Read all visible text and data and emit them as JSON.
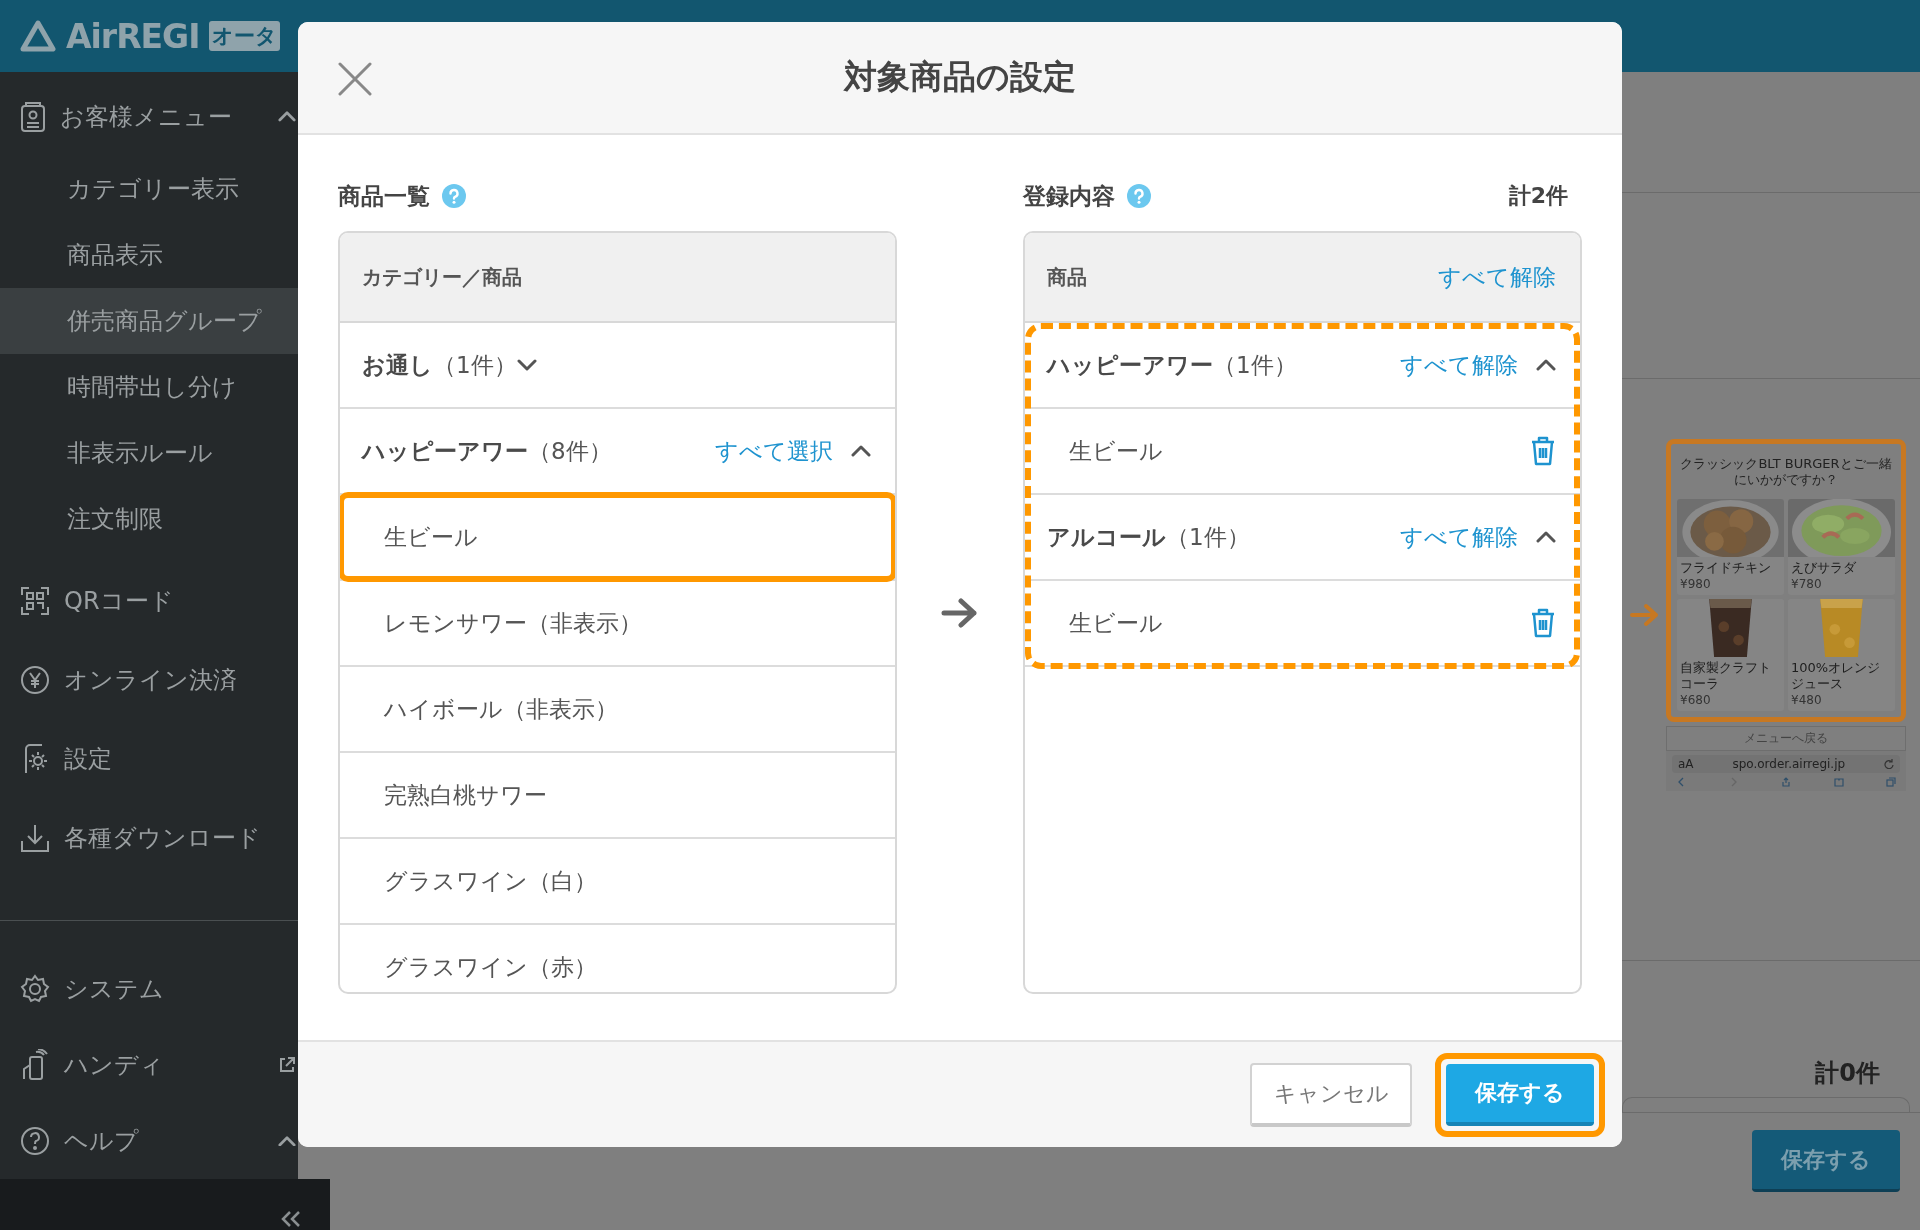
{
  "app_header": {
    "logo_text": "AirREGI",
    "logo_badge": "オータ"
  },
  "sidebar": {
    "items": [
      {
        "kind": "parent",
        "label": "お客様メニュー",
        "selected": false,
        "expanded": true,
        "children": [
          {
            "label": "カテゴリー表示",
            "selected": false
          },
          {
            "label": "商品表示",
            "selected": false
          },
          {
            "label": "併売商品グループ",
            "selected": true
          },
          {
            "label": "時間帯出し分け",
            "selected": false
          },
          {
            "label": "非表示ルール",
            "selected": false
          },
          {
            "label": "注文制限",
            "selected": false
          }
        ]
      },
      {
        "kind": "link",
        "label": "QRコード",
        "selected": false
      },
      {
        "kind": "link",
        "label": "オンライン決済",
        "selected": false
      },
      {
        "kind": "link",
        "label": "設定",
        "selected": false
      },
      {
        "kind": "link",
        "label": "各種ダウンロード",
        "selected": false
      }
    ],
    "bottom_items": [
      {
        "kind": "link",
        "label": "システム",
        "selected": false
      },
      {
        "kind": "external",
        "label": "ハンディ",
        "selected": false
      },
      {
        "kind": "parent",
        "label": "ヘルプ",
        "selected": false,
        "expanded": true
      }
    ]
  },
  "background_page": {
    "preview": {
      "title": "クラッシックBLT BURGERとご一緒にいかがですか？",
      "products": [
        {
          "name": "フライドチキン",
          "price": "¥980"
        },
        {
          "name": "えびサラダ",
          "price": "¥780"
        },
        {
          "name": "自家製クラフトコーラ",
          "price": "¥680"
        },
        {
          "name": "100%オレンジジュース",
          "price": "¥480"
        }
      ],
      "back_button": "メニューへ戻る",
      "text_size": "aA",
      "address": "spo.order.airregi.jp"
    },
    "total": "計0件",
    "save_button": "保存する"
  },
  "dialog": {
    "title": "対象商品の設定",
    "catalog": {
      "label": "商品一覧",
      "column_header": "カテゴリー／商品",
      "groups": [
        {
          "name": "**お通し**（1件）",
          "expanded": false
        },
        {
          "name": "**ハッピーアワー**（8件）",
          "expanded": true,
          "action": "すべて選択",
          "items": [
            {
              "name": "生ビール",
              "highlighted": true
            },
            {
              "name": "レモンサワー（非表示）",
              "highlighted": false
            },
            {
              "name": "ハイボール（非表示）",
              "highlighted": false
            },
            {
              "name": "完熟白桃サワー",
              "highlighted": false
            },
            {
              "name": "グラスワイン（白）",
              "highlighted": false
            },
            {
              "name": "グラスワイン（赤）",
              "highlighted": false
            }
          ]
        }
      ]
    },
    "registered": {
      "label": "登録内容",
      "total": "計2件",
      "column_header": "商品",
      "clear_all": "すべて解除",
      "highlighted": true,
      "groups": [
        {
          "name": "**ハッピーアワー**（1件）",
          "action": "すべて解除",
          "expanded": true,
          "items": [
            {
              "name": "生ビール"
            }
          ]
        },
        {
          "name": "**アルコール**（1件）",
          "action": "すべて解除",
          "expanded": true,
          "items": [
            {
              "name": "生ビール"
            }
          ]
        }
      ]
    },
    "buttons": [
      {
        "kind": "secondary",
        "label": "キャンセル",
        "highlighted": false
      },
      {
        "kind": "primary",
        "label": "保存する",
        "highlighted": true
      }
    ]
  }
}
